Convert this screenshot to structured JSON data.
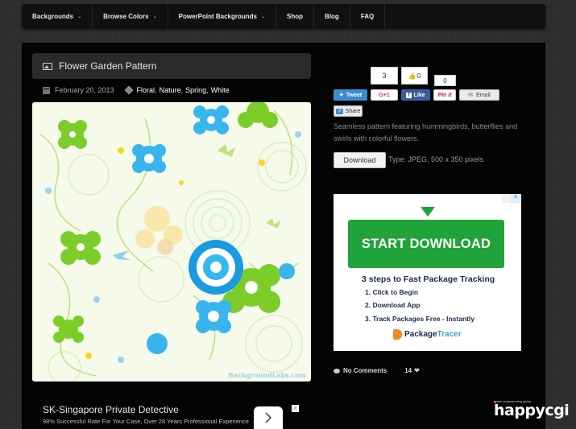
{
  "nav": {
    "items": [
      {
        "label": "Backgrounds",
        "has_dropdown": true
      },
      {
        "label": "Browse Colors",
        "has_dropdown": true
      },
      {
        "label": "PowerPoint Backgrounds",
        "has_dropdown": true
      },
      {
        "label": "Shop",
        "has_dropdown": false
      },
      {
        "label": "Blog",
        "has_dropdown": false
      },
      {
        "label": "FAQ",
        "has_dropdown": false
      }
    ]
  },
  "post": {
    "title": "Flower Garden Pattern",
    "date": "February 20, 2013",
    "tags": [
      "Floral",
      "Nature",
      "Spring",
      "White"
    ],
    "image_watermark": "BackgroundLabs.com"
  },
  "social": {
    "tweet_label": "Tweet",
    "gplus_label": "G+1",
    "gplus_count": "3",
    "fb_label": "Like",
    "fb_count": "0",
    "pin_label": "Pin it",
    "pin_count": "0",
    "email_label": "Email",
    "share_label": "Share"
  },
  "details": {
    "description": "Seamless pattern featuring hummingbirds, butterflies and swirls with colorful flowers.",
    "download_label": "Download",
    "type_text": "Type: JPEG, 500 x 350 pixels"
  },
  "ad_right": {
    "cta": "START DOWNLOAD",
    "heading": "3 steps to Fast Package Tracking",
    "steps": [
      "1. Click to Begin",
      "2. Download App",
      "3. Track Packages Free - Instantly"
    ],
    "brand_a": "Package",
    "brand_b": "Tracer"
  },
  "ad_bottom": {
    "title": "SK-Singapore Private Detective",
    "subtitle": "98% Successful Rate For Your Case, Over 28 Years Professional Experience"
  },
  "footer_meta": {
    "comments": "No Comments",
    "likes": "14"
  },
  "logo": {
    "small": "web programming group",
    "big": "happycgi"
  },
  "colors": {
    "accent_green": "#20a33a",
    "twitter": "#3b8dd1",
    "facebook": "#3a5d9f",
    "gplus": "#d8412e",
    "pinterest": "#c9222a"
  }
}
